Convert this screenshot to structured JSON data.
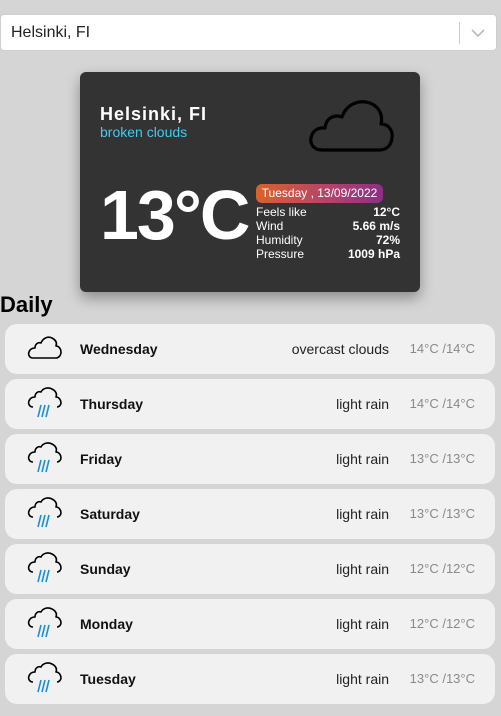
{
  "city_select": {
    "value": "Helsinki, FI"
  },
  "current": {
    "city": "Helsinki, FI",
    "description": "broken clouds",
    "icon": "cloud-icon",
    "temperature": "13°C",
    "date": "Tuesday , 13/09/2022",
    "details": [
      {
        "label": "Feels like",
        "value": "12°C"
      },
      {
        "label": "Wind",
        "value": "5.66 m/s"
      },
      {
        "label": "Humidity",
        "value": "72%"
      },
      {
        "label": "Pressure",
        "value": "1009 hPa"
      }
    ]
  },
  "daily": {
    "title": "Daily",
    "items": [
      {
        "day": "Wednesday",
        "description": "overcast clouds",
        "temp": "14°C /14°C",
        "icon": "cloud-icon"
      },
      {
        "day": "Thursday",
        "description": "light rain",
        "temp": "14°C /14°C",
        "icon": "rain-cloud-icon"
      },
      {
        "day": "Friday",
        "description": "light rain",
        "temp": "13°C /13°C",
        "icon": "rain-cloud-icon"
      },
      {
        "day": "Saturday",
        "description": "light rain",
        "temp": "13°C /13°C",
        "icon": "rain-cloud-icon"
      },
      {
        "day": "Sunday",
        "description": "light rain",
        "temp": "12°C /12°C",
        "icon": "rain-cloud-icon"
      },
      {
        "day": "Monday",
        "description": "light rain",
        "temp": "12°C /12°C",
        "icon": "rain-cloud-icon"
      },
      {
        "day": "Tuesday",
        "description": "light rain",
        "temp": "13°C /13°C",
        "icon": "rain-cloud-icon"
      }
    ]
  },
  "colors": {
    "page_bg": "#d6d5d6",
    "card_bg": "#333333",
    "description_accent": "#3ccdf2",
    "date_gradient": [
      "#d9622b",
      "#8d2f86"
    ],
    "rain_drops": "#1e8fd0"
  }
}
